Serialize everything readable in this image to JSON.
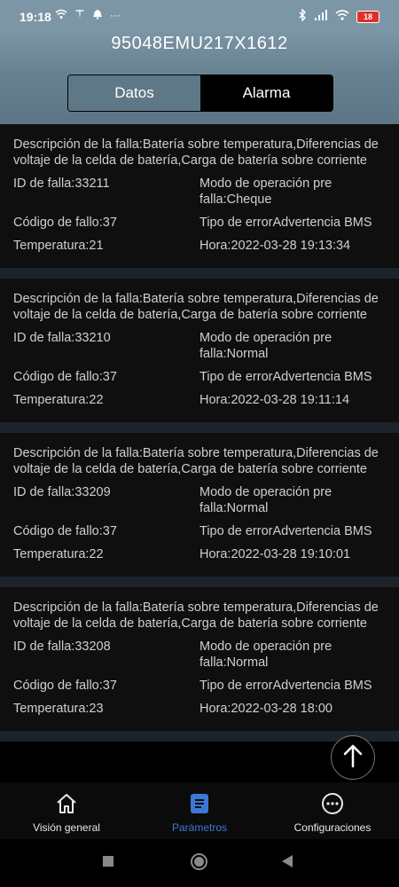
{
  "status_bar": {
    "time": "19:18",
    "battery": "18",
    "dots": "···"
  },
  "header": {
    "device_id": "95048EMU217X1612"
  },
  "tabs": [
    {
      "label": "Datos",
      "active": false
    },
    {
      "label": "Alarma",
      "active": true
    }
  ],
  "alarms": [
    {
      "description": "Descripción de la falla:Batería sobre temperatura,Diferencias de voltaje de la celda de batería,Carga de batería sobre corriente",
      "fault_id": "ID de falla:33211",
      "pre_fault_mode": "Modo de operación pre falla:Cheque",
      "fault_code": "Código de fallo:37",
      "error_type": "Tipo de errorAdvertencia BMS",
      "temperature": "Temperatura:21",
      "time": "Hora:2022-03-28 19:13:34"
    },
    {
      "description": "Descripción de la falla:Batería sobre temperatura,Diferencias de voltaje de la celda de batería,Carga de batería sobre corriente",
      "fault_id": "ID de falla:33210",
      "pre_fault_mode": "Modo de operación pre falla:Normal",
      "fault_code": "Código de fallo:37",
      "error_type": "Tipo de errorAdvertencia BMS",
      "temperature": "Temperatura:22",
      "time": "Hora:2022-03-28 19:11:14"
    },
    {
      "description": "Descripción de la falla:Batería sobre temperatura,Diferencias de voltaje de la celda de batería,Carga de batería sobre corriente",
      "fault_id": "ID de falla:33209",
      "pre_fault_mode": "Modo de operación pre falla:Normal",
      "fault_code": "Código de fallo:37",
      "error_type": "Tipo de errorAdvertencia BMS",
      "temperature": "Temperatura:22",
      "time": "Hora:2022-03-28 19:10:01"
    },
    {
      "description": "Descripción de la falla:Batería sobre temperatura,Diferencias de voltaje de la celda de batería,Carga de batería sobre corriente",
      "fault_id": "ID de falla:33208",
      "pre_fault_mode": "Modo de operación pre falla:Normal",
      "fault_code": "Código de fallo:37",
      "error_type": "Tipo de errorAdvertencia BMS",
      "temperature": "Temperatura:23",
      "time": "Hora:2022-03-28 18:00"
    }
  ],
  "bottom_nav": [
    {
      "label": "Visión general",
      "icon": "home-icon",
      "active": false
    },
    {
      "label": "Parámetros",
      "icon": "document-icon",
      "active": true
    },
    {
      "label": "Configuraciones",
      "icon": "more-icon",
      "active": false
    }
  ],
  "colors": {
    "accent": "#3c78d8",
    "header": "#6a8393",
    "battery": "#e0302a"
  }
}
